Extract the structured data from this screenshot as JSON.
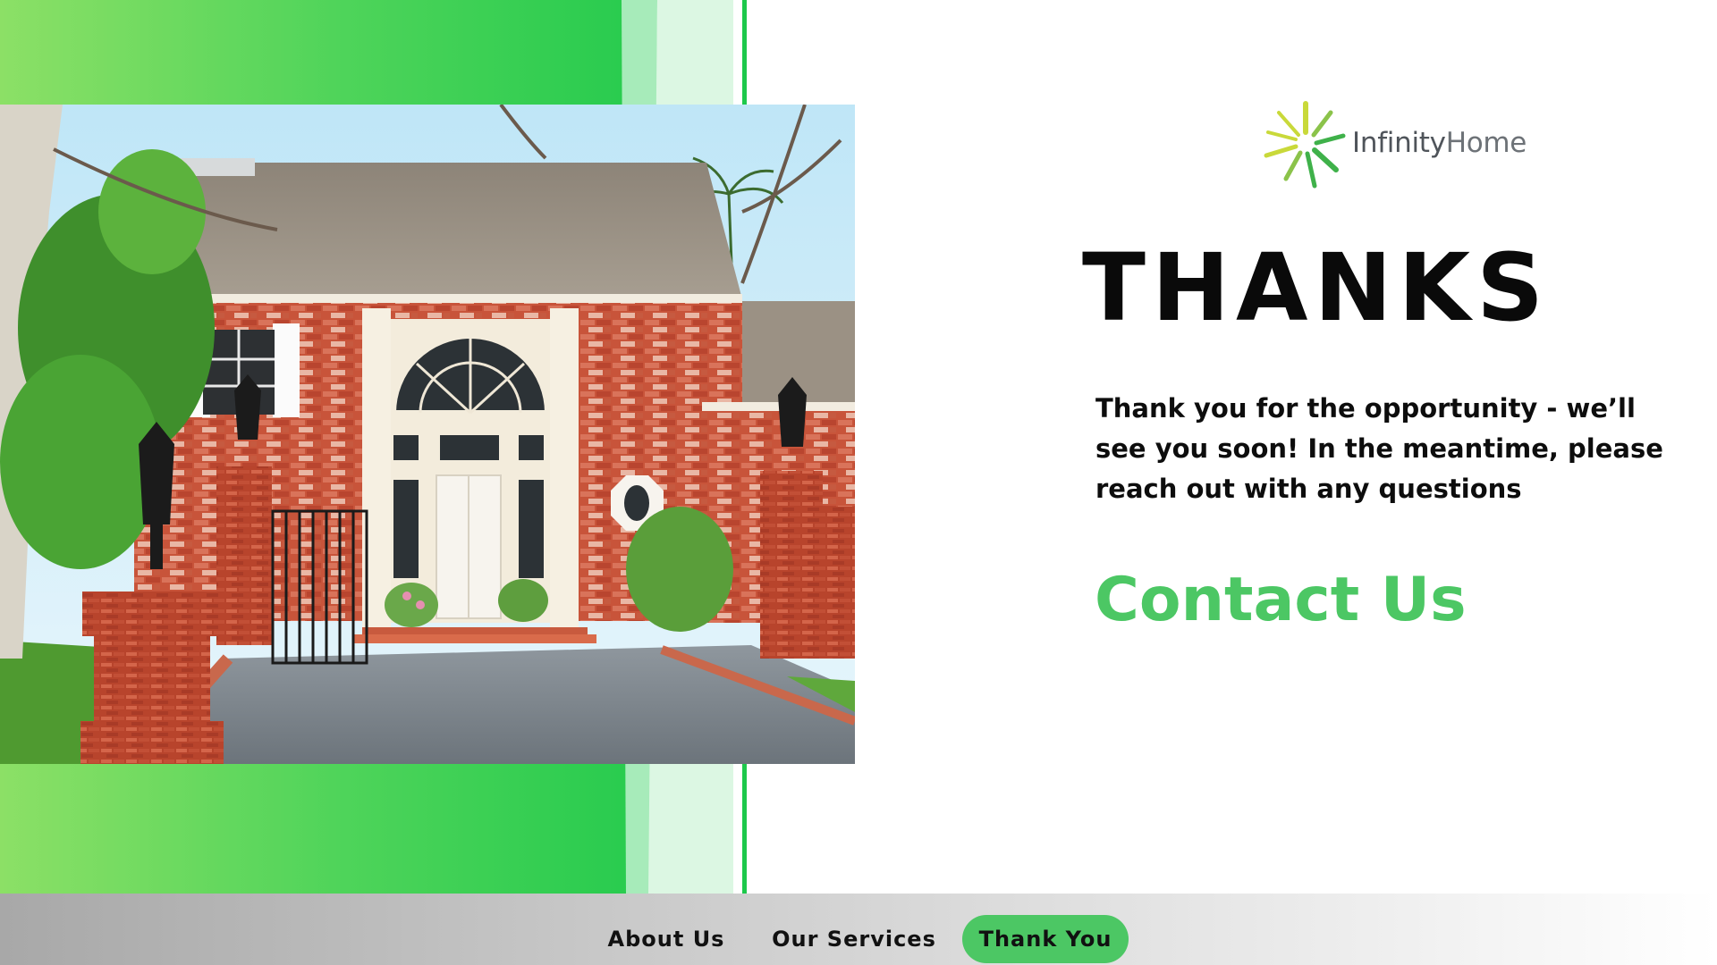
{
  "logo": {
    "name_part1": "Infinity",
    "name_part2": "Home",
    "icon": "starburst-logo-icon",
    "colors": [
      "#c9d93a",
      "#8bc34a",
      "#3fb14a"
    ]
  },
  "main": {
    "title": "THANKS",
    "message": "Thank you for the opportunity - we’ll see you soon! In the meantime, please reach out with any questions",
    "contact_link": "Contact Us"
  },
  "nav": {
    "items": [
      {
        "label": "About Us",
        "active": false
      },
      {
        "label": "Our Services",
        "active": false
      },
      {
        "label": "Thank You",
        "active": true
      }
    ]
  },
  "colors": {
    "accent_green": "#4cc764",
    "panel_green": "#19c84a",
    "title_black": "#0a0a0a"
  },
  "photo": {
    "subject": "house-photo"
  }
}
